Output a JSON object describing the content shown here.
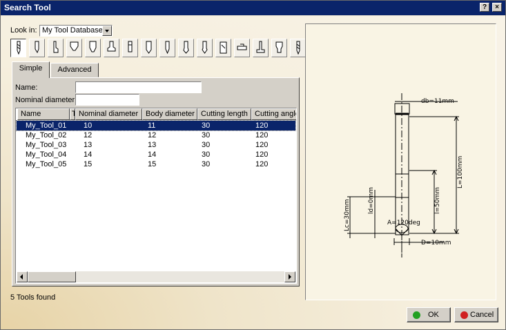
{
  "window": {
    "title": "Search Tool",
    "help_label": "?",
    "close_label": "×"
  },
  "look_in": {
    "label": "Look in:",
    "value": "My Tool Database"
  },
  "toolbar": {
    "buttons": [
      "end-mill-icon",
      "tool-1-icon",
      "tool-2-icon",
      "tool-3-icon",
      "tool-4-icon",
      "tool-5-icon",
      "tool-6-icon",
      "tool-7-icon",
      "tool-8-icon",
      "tool-9-icon",
      "tool-10-icon",
      "tool-11-icon",
      "tool-12-icon",
      "tool-13-icon",
      "tool-14-icon",
      "tool-15-icon"
    ],
    "selected_index": 0
  },
  "tabs": [
    {
      "label": "Simple",
      "active": true
    },
    {
      "label": "Advanced",
      "active": false
    }
  ],
  "form": {
    "name_label": "Name:",
    "name_value": "",
    "diameter_label": "Nominal diameter:",
    "diameter_value": ""
  },
  "table": {
    "columns": [
      "Name",
      "T",
      "Nominal diameter",
      "Body diameter",
      "Cutting length",
      "Cutting angle"
    ],
    "rows": [
      [
        "My_Tool_01",
        "10",
        "11",
        "30",
        "120"
      ],
      [
        "My_Tool_02",
        "12",
        "12",
        "30",
        "120"
      ],
      [
        "My_Tool_03",
        "13",
        "13",
        "30",
        "120"
      ],
      [
        "My_Tool_04",
        "14",
        "14",
        "30",
        "120"
      ],
      [
        "My_Tool_05",
        "15",
        "15",
        "30",
        "120"
      ]
    ],
    "selected_row": 0
  },
  "status_text": "5 Tools found",
  "drawing": {
    "db_label": "db=11mm",
    "L_label": "L=100mm",
    "l_label": "l=50mm",
    "ld_label": "ld=0mm",
    "lc_label": "Lc=30mm",
    "angle_label": "A=120deg",
    "D_label": "D=10mm"
  },
  "buttons": {
    "ok_label": "OK",
    "cancel_label": "Cancel"
  },
  "colors": {
    "titlebar": "#0a246a",
    "selection": "#0a246a",
    "ok_dot": "#22a022",
    "cancel_dot": "#d02020"
  }
}
